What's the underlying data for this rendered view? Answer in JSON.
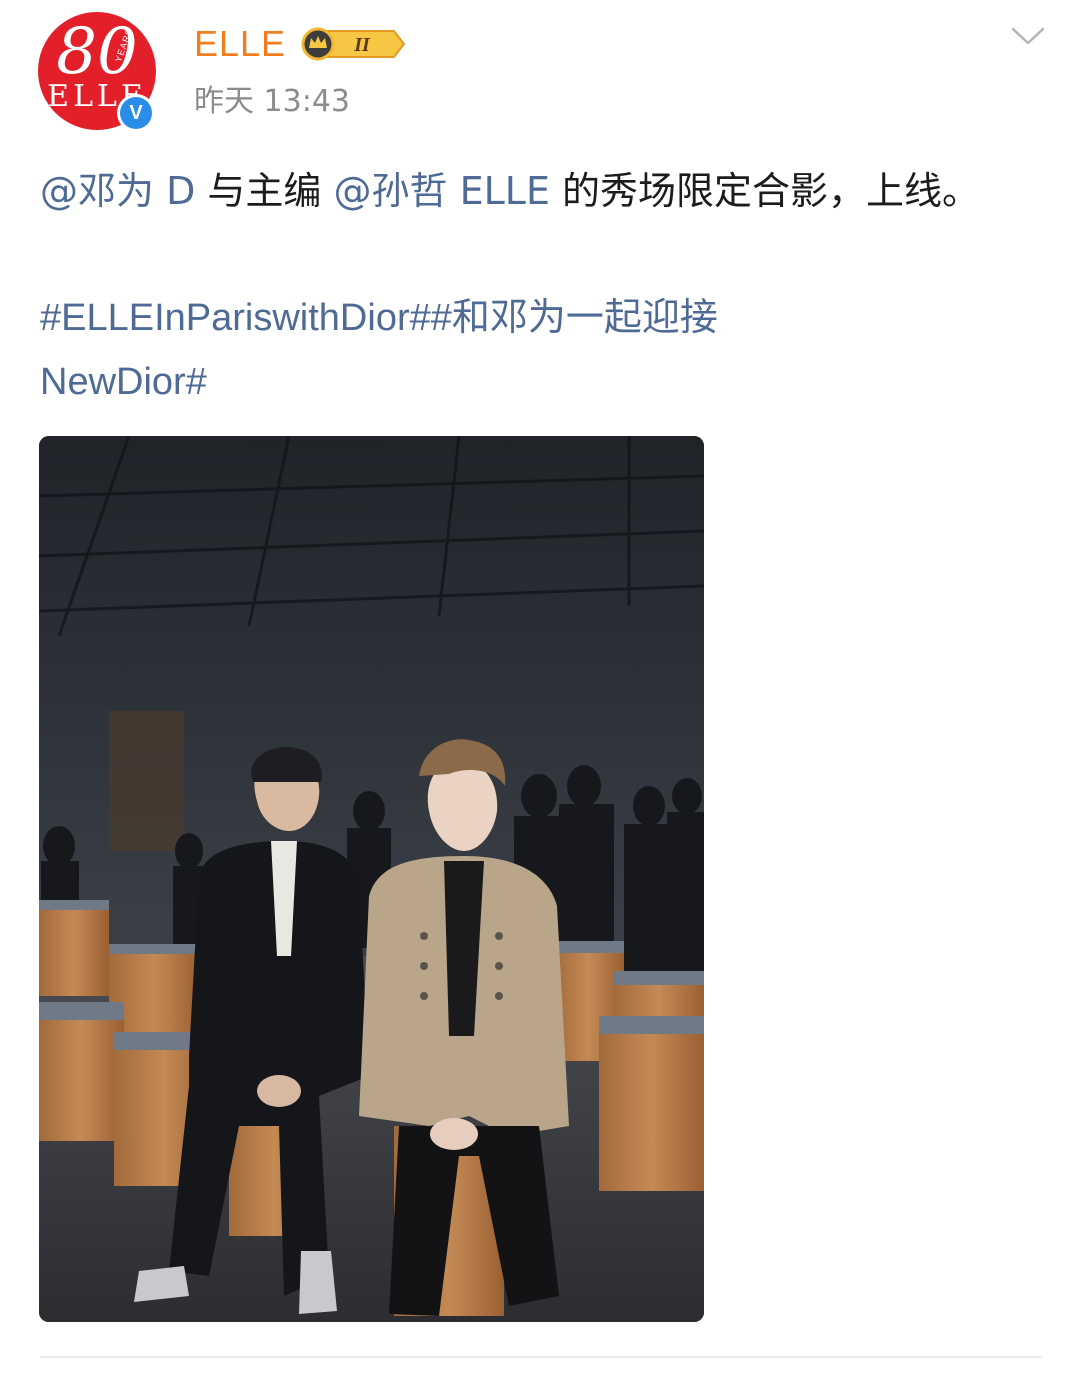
{
  "post": {
    "username": "ELLE",
    "vip_level": "II",
    "timestamp": "昨天 13:43",
    "avatar": {
      "number": "80",
      "years": "YEARS",
      "brand": "ELLE",
      "badge": "V"
    },
    "text": {
      "mention1": "@邓为 D",
      "part1": " 与主编 ",
      "mention2": "@孙哲 ELLE",
      "part2": " 的秀场限定合影，上线。"
    },
    "hashtags": {
      "tag1": "#ELLEInPariswithDior#",
      "tag2": "#和邓为一起迎接NewDior#"
    }
  },
  "colors": {
    "link": "#4f6b95",
    "username": "#f07d1e",
    "avatar_bg": "#e3202a",
    "verified": "#2a8ee8",
    "timestamp": "#8c8c8c"
  },
  "icons": {
    "menu": "chevron-down-icon",
    "verified": "verified-badge-icon",
    "vip": "crown-vip-badge-icon"
  }
}
